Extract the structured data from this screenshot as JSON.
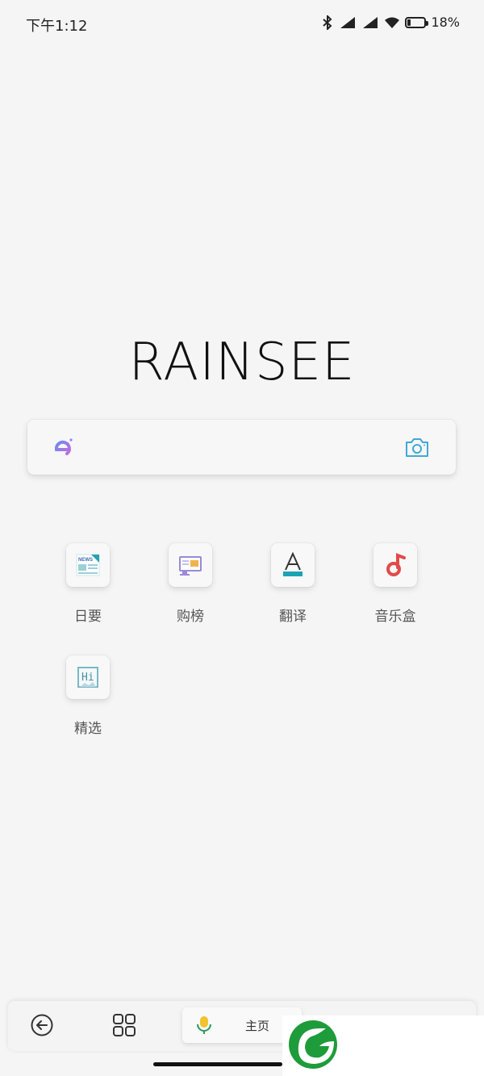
{
  "status_bar": {
    "time": "下午1:12",
    "battery_percent": "18%",
    "battery_level": 0.18,
    "icons": [
      "bluetooth-icon",
      "signal-icon",
      "signal-icon",
      "wifi-icon",
      "battery-icon"
    ]
  },
  "logo": {
    "text": "RAINSEE"
  },
  "search": {
    "engine_icon": "search-engine-icon",
    "camera_icon": "camera-icon",
    "accent": "#3fa9d6"
  },
  "shortcuts": [
    {
      "label": "日要",
      "icon": "news-icon"
    },
    {
      "label": "购榜",
      "icon": "shopping-rank-icon"
    },
    {
      "label": "翻译",
      "icon": "translate-icon"
    },
    {
      "label": "音乐盒",
      "icon": "music-note-icon"
    },
    {
      "label": "精选",
      "icon": "hi-featured-icon"
    }
  ],
  "toolbar": {
    "back_icon": "back-arrow-icon",
    "grid_icon": "grid-icon",
    "home_label": "主页",
    "mic_icon": "mic-icon"
  },
  "colors": {
    "background": "#f5f5f5",
    "music_red": "#e24a4a",
    "translate_teal": "#1aa3b3",
    "mic_yellow": "#f2c230",
    "mic_green": "#2a9d5f"
  }
}
